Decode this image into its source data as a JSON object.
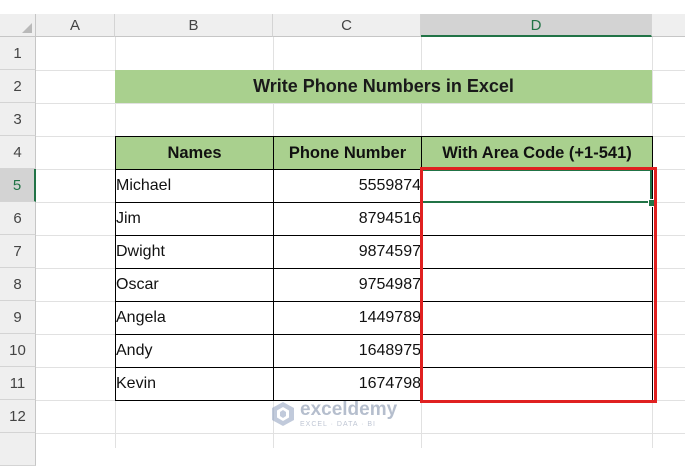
{
  "columns": [
    "A",
    "B",
    "C",
    "D"
  ],
  "selected_column": "D",
  "rows": [
    "1",
    "2",
    "3",
    "4",
    "5",
    "6",
    "7",
    "8",
    "9",
    "10",
    "11",
    "12"
  ],
  "selected_row": "5",
  "title": "Write Phone Numbers in Excel",
  "table": {
    "headers": [
      "Names",
      "Phone Number",
      "With Area Code (+1-541)"
    ],
    "rows": [
      {
        "name": "Michael",
        "phone": "5559874",
        "area": ""
      },
      {
        "name": "Jim",
        "phone": "8794516",
        "area": ""
      },
      {
        "name": "Dwight",
        "phone": "9874597",
        "area": ""
      },
      {
        "name": "Oscar",
        "phone": "9754987",
        "area": ""
      },
      {
        "name": "Angela",
        "phone": "1449789",
        "area": ""
      },
      {
        "name": "Andy",
        "phone": "1648975",
        "area": ""
      },
      {
        "name": "Kevin",
        "phone": "1674798",
        "area": ""
      }
    ]
  },
  "colors": {
    "header_fill": "#a9d08e",
    "highlight_border": "#e02020",
    "excel_green": "#217346"
  },
  "watermark": {
    "name": "exceldemy",
    "tagline": "EXCEL · DATA · BI",
    "icon": "exceldemy-logo-icon"
  }
}
